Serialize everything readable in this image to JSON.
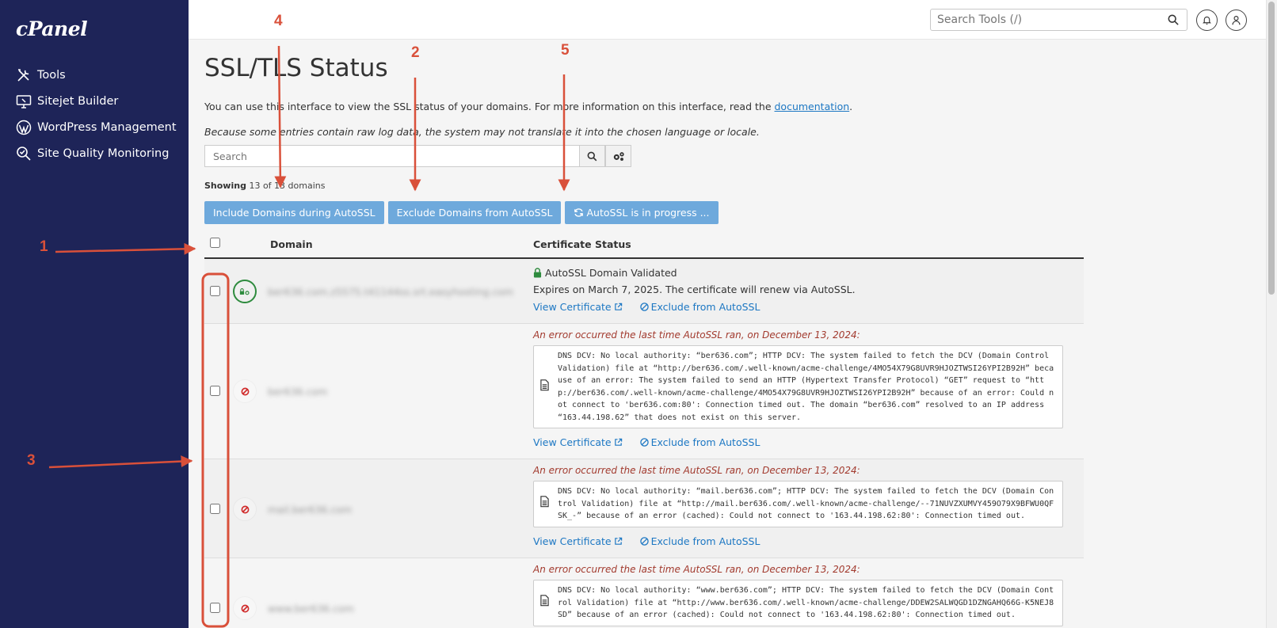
{
  "app": {
    "logo": "cPanel"
  },
  "sidebar": {
    "items": [
      {
        "label": "Tools",
        "icon": "tools-icon"
      },
      {
        "label": "Sitejet Builder",
        "icon": "sitejet-icon"
      },
      {
        "label": "WordPress Management",
        "icon": "wordpress-icon"
      },
      {
        "label": "Site Quality Monitoring",
        "icon": "site-quality-icon"
      }
    ]
  },
  "topbar": {
    "search_placeholder": "Search Tools (/)"
  },
  "page": {
    "title": "SSL/TLS Status",
    "intro": "You can use this interface to view the SSL status of your domains. For more information on this interface, read the ",
    "intro_link": "documentation",
    "intro_end": ".",
    "note": "Because some entries contain raw log data, the system may not translate it into the chosen language or locale.",
    "search_placeholder": "Search",
    "showing_label": "Showing",
    "showing_count": "13 of 13 domains"
  },
  "buttons": {
    "include": "Include Domains during AutoSSL",
    "exclude": "Exclude Domains from AutoSSL",
    "progress": "AutoSSL is in progress ..."
  },
  "table": {
    "headers": {
      "domain": "Domain",
      "status": "Certificate Status"
    },
    "link_view": "View Certificate",
    "link_exclude": "Exclude from AutoSSL",
    "rows": [
      {
        "domain": "ber636.com.z5575.t41144ss.srt.easyhosting.com",
        "validated": "AutoSSL Domain Validated",
        "expires": "Expires on March 7, 2025. The certificate will renew via AutoSSL."
      },
      {
        "domain": "ber636.com",
        "error_title": "An error occurred the last time AutoSSL ran, on December 13, 2024:",
        "error": "DNS DCV: No local authority: “ber636.com”; HTTP DCV: The system failed to fetch the DCV (Domain Control Validation) file at “http://ber636.com/.well-known/acme-challenge/4MO54X79G8UVR9HJOZTWSI26YPI2B92H” because of an error: The system failed to send an HTTP (Hypertext Transfer Protocol) “GET” request to “http://ber636.com/.well-known/acme-challenge/4MO54X79G8UVR9HJOZTWSI26YPI2B92H” because of an error: Could not connect to 'ber636.com:80': Connection timed out. The domain “ber636.com” resolved to an IP address “163.44.198.62” that does not exist on this server."
      },
      {
        "domain": "mail.ber636.com",
        "error_title": "An error occurred the last time AutoSSL ran, on December 13, 2024:",
        "error": "DNS DCV: No local authority: “mail.ber636.com”; HTTP DCV: The system failed to fetch the DCV (Domain Control Validation) file at “http://mail.ber636.com/.well-known/acme-challenge/--71NUVZXUMVY459O79X9BFWU0QFSK_-” because of an error (cached): Could not connect to '163.44.198.62:80': Connection timed out."
      },
      {
        "domain": "www.ber636.com",
        "error_title": "An error occurred the last time AutoSSL ran, on December 13, 2024:",
        "error": "DNS DCV: No local authority: “www.ber636.com”; HTTP DCV: The system failed to fetch the DCV (Domain Control Validation) file at “http://www.ber636.com/.well-known/acme-challenge/DDEW2SALWQGD1DZNGAHQ66G-K5NEJ8SD” because of an error (cached): Could not connect to '163.44.198.62:80': Connection timed out."
      }
    ]
  },
  "annotations": {
    "n1": "1",
    "n2": "2",
    "n3": "3",
    "n4": "4",
    "n5": "5",
    "color": "#d9503a"
  }
}
